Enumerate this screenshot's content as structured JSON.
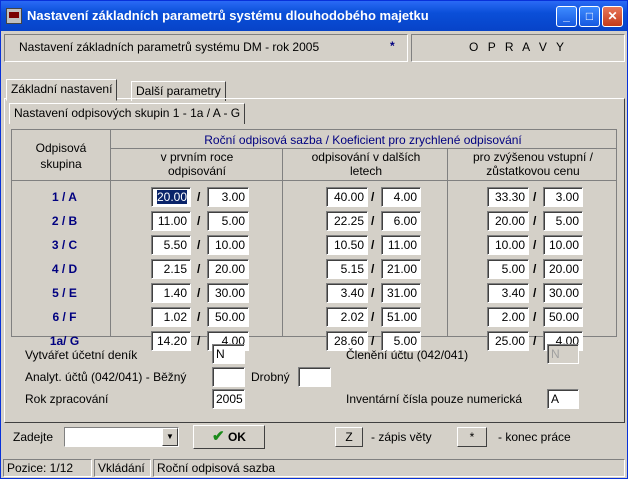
{
  "window": {
    "title": "Nastavení základních parametrů systému dlouhodobého majetku",
    "min": "_",
    "max": "□",
    "close": "✕"
  },
  "header": {
    "left_text": "Nastavení základních parametrů systému DM  - rok 2005",
    "star": "*",
    "right_text": "O P R A V Y"
  },
  "tabs": {
    "main": [
      "Základní nastavení",
      "Další parametry"
    ],
    "sub": "Nastavení odpisových skupin  1 - 1a / A - G"
  },
  "grid": {
    "col_group_label": "Odpisová skupina",
    "main_header": "Roční odpisová sazba / Koeficient pro zrychlené odpisování",
    "sub_headers": [
      "v prvním roce odpisování",
      "odpisování v dalších letech",
      "pro zvýšenou vstupní / zůstatkovou cenu"
    ],
    "slash": "/",
    "rows": [
      {
        "group": "1 / A",
        "v": [
          "20.00",
          "3.00",
          "40.00",
          "4.00",
          "33.30",
          "3.00"
        ]
      },
      {
        "group": "2 / B",
        "v": [
          "11.00",
          "5.00",
          "22.25",
          "6.00",
          "20.00",
          "5.00"
        ]
      },
      {
        "group": "3 / C",
        "v": [
          "5.50",
          "10.00",
          "10.50",
          "11.00",
          "10.00",
          "10.00"
        ]
      },
      {
        "group": "4 / D",
        "v": [
          "2.15",
          "20.00",
          "5.15",
          "21.00",
          "5.00",
          "20.00"
        ]
      },
      {
        "group": "5 / E",
        "v": [
          "1.40",
          "30.00",
          "3.40",
          "31.00",
          "3.40",
          "30.00"
        ]
      },
      {
        "group": "6 / F",
        "v": [
          "1.02",
          "50.00",
          "2.02",
          "51.00",
          "2.00",
          "50.00"
        ]
      },
      {
        "group": "1a/ G",
        "v": [
          "14.20",
          "4.00",
          "28.60",
          "5.00",
          "25.00",
          "4.00"
        ]
      }
    ]
  },
  "form": {
    "journal_label": "Vytvářet účetní deník",
    "journal_value": "N",
    "split_label": "Členění účtu (042/041)",
    "split_value": "N",
    "analyt_label": "Analyt. účtů (042/041) - Běžný",
    "analyt_value": "",
    "drobny_label": "Drobný",
    "drobny_value": "",
    "year_label": "Rok zpracování",
    "year_value": "2005",
    "inventory_label": "Inventární čísla pouze numerická",
    "inventory_value": "A"
  },
  "bottom": {
    "zadejte": "Zadejte",
    "combo_value": "",
    "ok": "OK",
    "z_key": "Z",
    "z_text": "- zápis věty",
    "star_key": "*",
    "star_text": "- konec práce"
  },
  "status": {
    "pos": "Pozice: 1/12",
    "mode": "Vkládání",
    "field": "Roční odpisová sazba"
  }
}
